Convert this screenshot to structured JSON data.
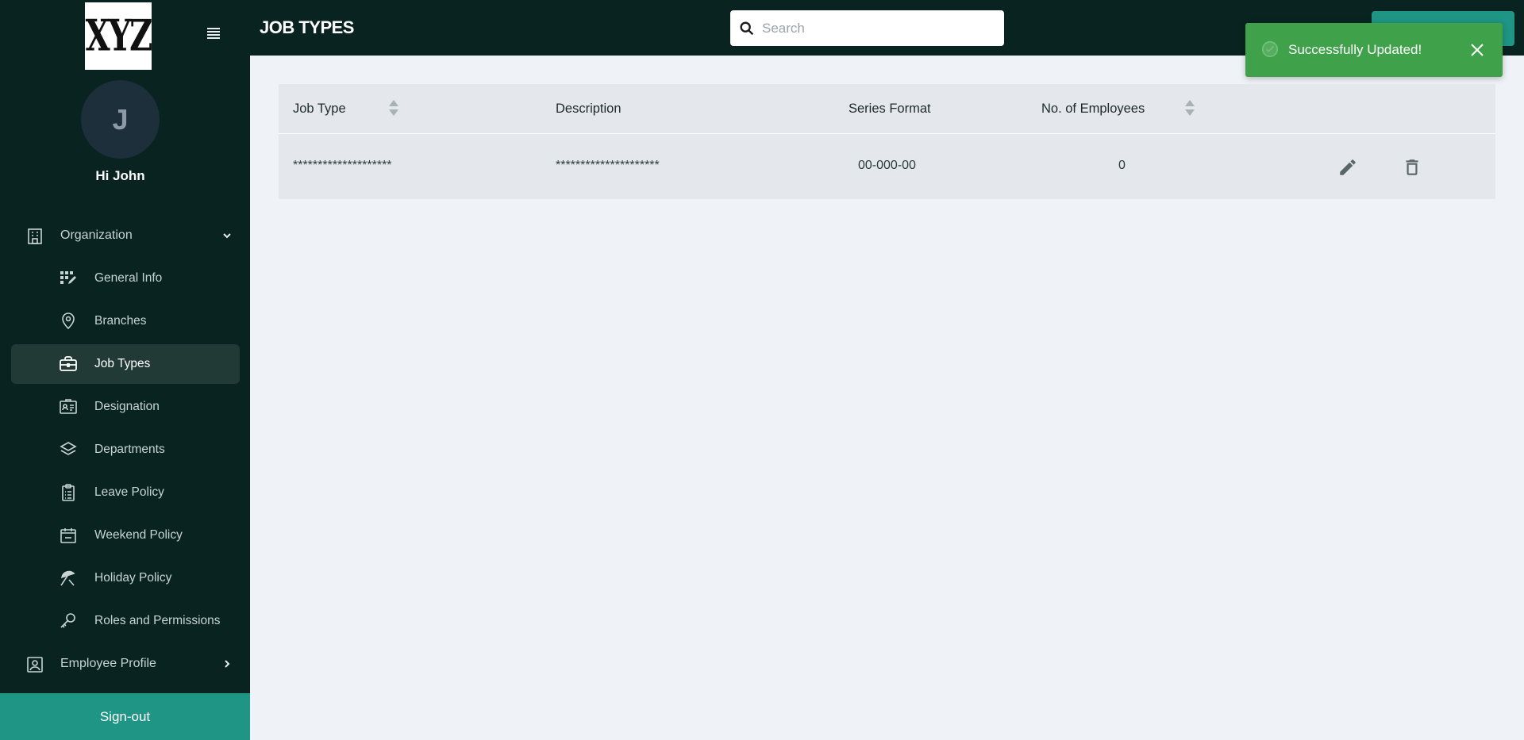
{
  "sidebar": {
    "logo_text": "XYZ",
    "avatar_initial": "J",
    "greeting": "Hi John",
    "group_organization": "Organization",
    "items": [
      {
        "label": "General Info",
        "icon": "grid-edit-icon"
      },
      {
        "label": "Branches",
        "icon": "map-pin-icon"
      },
      {
        "label": "Job Types",
        "icon": "briefcase-icon",
        "active": true
      },
      {
        "label": "Designation",
        "icon": "id-card-icon"
      },
      {
        "label": "Departments",
        "icon": "layers-icon"
      },
      {
        "label": "Leave Policy",
        "icon": "clipboard-list-icon"
      },
      {
        "label": "Weekend Policy",
        "icon": "calendar-icon"
      },
      {
        "label": "Holiday Policy",
        "icon": "beach-umbrella-icon"
      },
      {
        "label": "Roles and Permissions",
        "icon": "key-icon"
      }
    ],
    "group_employee_profile": "Employee Profile",
    "signout": "Sign-out"
  },
  "header": {
    "title": "JOB TYPES",
    "search_placeholder": "Search"
  },
  "toast": {
    "message": "Successfully Updated!",
    "color": "#3fa24b"
  },
  "table": {
    "columns": [
      "Job Type",
      "Description",
      "Series Format",
      "No. of Employees"
    ],
    "rows": [
      {
        "job_type": "********************",
        "description": "*********************",
        "series_format": "00-000-00",
        "employees": "0"
      }
    ]
  },
  "colors": {
    "sidebar_bg": "#082320",
    "accent": "#1f9585",
    "active_item": "#213a36"
  }
}
